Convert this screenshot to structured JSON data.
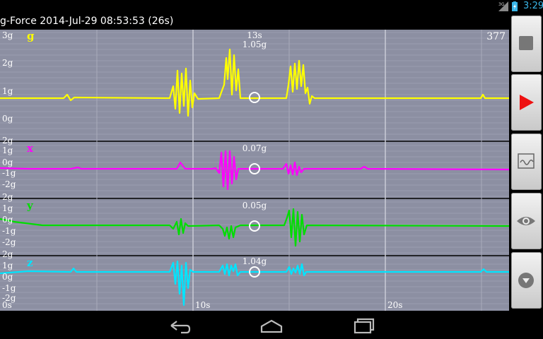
{
  "status_bar": {
    "time": "3:29",
    "network": "3G",
    "signal_icon": "signal-icon",
    "battery_icon": "battery-charging-icon"
  },
  "app": {
    "title": "g-Force 2014-Jul-29 08:53:53 (26s)"
  },
  "counter": "377",
  "cursor_time": "13s",
  "time_labels": [
    "0s",
    "10s",
    "20s"
  ],
  "colors": {
    "g": "#ffff00",
    "x": "#ff00ff",
    "y": "#00dd00",
    "z": "#00e5ff",
    "background": "#8c8fa2",
    "grid": "#b0b3c2",
    "axis_text": "#ffffff"
  },
  "panels": [
    {
      "id": "g",
      "label": "g",
      "value": "1.05g",
      "ticks": [
        "3g",
        "2g",
        "1g",
        "0g"
      ]
    },
    {
      "id": "x",
      "label": "x",
      "value": "0.07g",
      "ticks": [
        "2g",
        "1g",
        "0g",
        "-1g",
        "-2g"
      ]
    },
    {
      "id": "y",
      "label": "y",
      "value": "0.05g",
      "ticks": [
        "2g",
        "1g",
        "0g",
        "-1g",
        "-2g"
      ]
    },
    {
      "id": "z",
      "label": "z",
      "value": "1.04g",
      "ticks": [
        "2g",
        "1g",
        "0g",
        "-1g",
        "-2g"
      ]
    }
  ],
  "sidebar": [
    {
      "name": "stop-button",
      "icon": "stop-icon"
    },
    {
      "name": "play-button",
      "icon": "play-icon"
    },
    {
      "name": "waveform-button",
      "icon": "waveform-icon"
    },
    {
      "name": "view-button",
      "icon": "eye-icon"
    },
    {
      "name": "menu-button",
      "icon": "chevron-down-circle-icon"
    }
  ],
  "nav_bar": [
    {
      "name": "back-button",
      "icon": "back-icon"
    },
    {
      "name": "home-button",
      "icon": "home-icon"
    },
    {
      "name": "recents-button",
      "icon": "recents-icon"
    }
  ]
}
